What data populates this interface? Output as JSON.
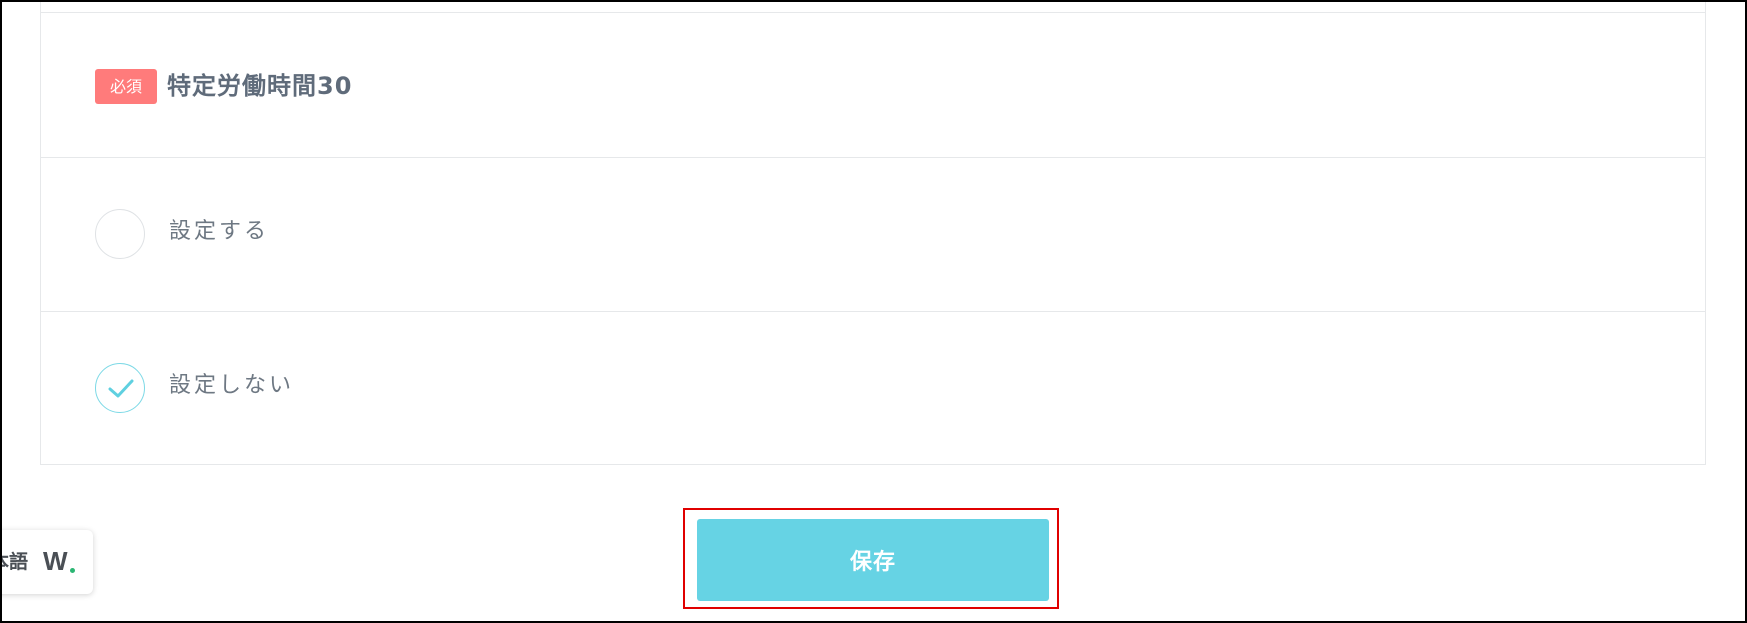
{
  "field": {
    "required_badge": "必須",
    "title": "特定労働時間30"
  },
  "options": [
    {
      "label": "設定する",
      "checked": false
    },
    {
      "label": "設定しない",
      "checked": true
    }
  ],
  "actions": {
    "save_label": "保存"
  },
  "language_widget": {
    "label": "本語",
    "logo_text": "W",
    "logo_dot_color": "#2bb673"
  },
  "colors": {
    "required_badge": "#ff7b7b",
    "primary_button": "#66d3e4",
    "check_accent": "#5fd0e0",
    "highlight_border": "#e00000"
  }
}
